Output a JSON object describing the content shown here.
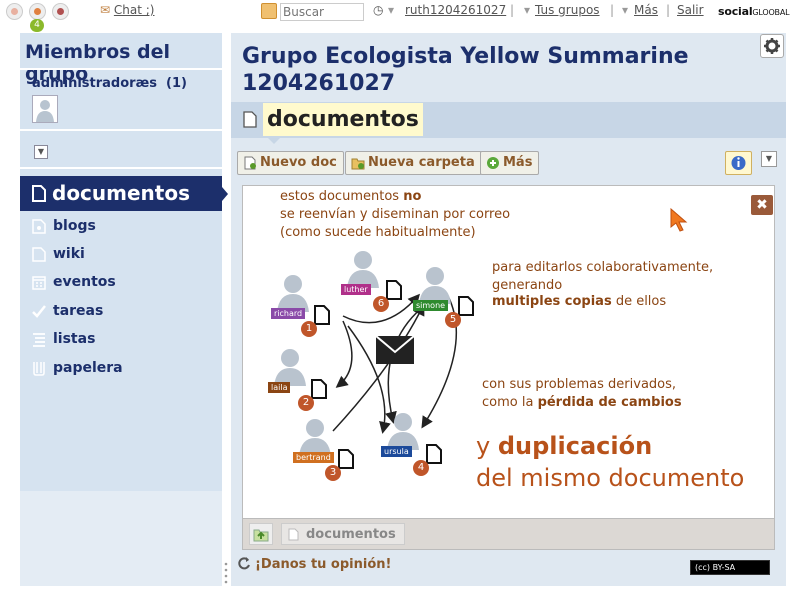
{
  "topbar": {
    "chat": "Chat ;)",
    "notif_count": "4",
    "search_placeholder": "Buscar",
    "user": "ruth1204261027",
    "groups": "Tus grupos",
    "more": "Más",
    "logout": "Salir",
    "logo_main": "social",
    "logo_sub": "GLOOBAL"
  },
  "sidebar": {
    "title": "Miembros del grupo",
    "admins_label": "administradoræs",
    "admins_count": "(1)",
    "active": "documentos",
    "items": [
      "blogs",
      "wiki",
      "eventos",
      "tareas",
      "listas",
      "papelera"
    ]
  },
  "main": {
    "title": "Grupo Ecologista Yellow Summarine 1204261027",
    "tab": "documentos",
    "buttons": {
      "new_doc": "Nuevo doc",
      "new_folder": "Nueva carpeta",
      "more": "Más"
    },
    "breadcrumb": "documentos",
    "feedback": "¡Danos tu opinión!",
    "license": "(cc) BY-SA"
  },
  "diagram": {
    "line1a": "estos documentos ",
    "line1b": "no",
    "line2": "se reenvían y diseminan por correo",
    "line3": "(como sucede habitualmente)",
    "r1": "para editarlos colaborativamente,",
    "r2": "generando",
    "r3a": "multiples copias",
    "r3b": " de ellos",
    "p1": "con sus problemas derivados,",
    "p2a": "como la ",
    "p2b": "pérdida de cambios",
    "big1a": "y ",
    "big1b": "duplicación",
    "big2": "del mismo documento",
    "people": [
      {
        "name": "richard",
        "num": "1",
        "color": "#8a4aa8"
      },
      {
        "name": "luther",
        "num": "6",
        "color": "#b0308a"
      },
      {
        "name": "simone",
        "num": "5",
        "color": "#2e8a2e"
      },
      {
        "name": "laila",
        "num": "2",
        "color": "#8b4513"
      },
      {
        "name": "bertrand",
        "num": "3",
        "color": "#d07020"
      },
      {
        "name": "ursula",
        "num": "4",
        "color": "#1c4a9a"
      }
    ]
  },
  "colors": {
    "navy": "#1c2f6b",
    "brown": "#8b5a2b",
    "sidebar_bg": "#d6e3f0"
  }
}
